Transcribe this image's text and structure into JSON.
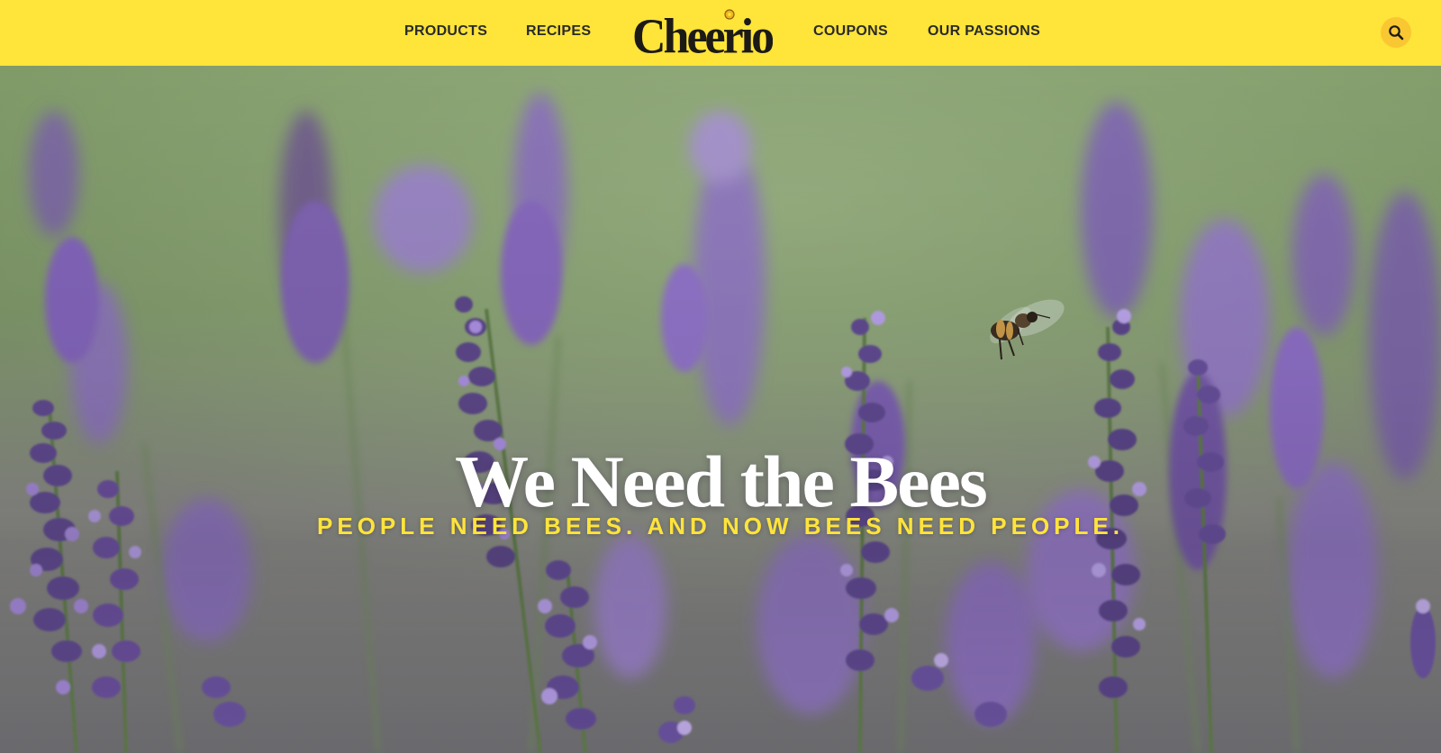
{
  "brand": {
    "logo_text": "Cheerios",
    "nav_bg": "#ffe43a",
    "accent_yellow": "#ffe43a",
    "search_bg": "#f9c731"
  },
  "nav": {
    "products": "PRODUCTS",
    "recipes": "RECIPES",
    "coupons": "COUPONS",
    "passions": "OUR PASSIONS",
    "search_icon": "search-icon"
  },
  "hero": {
    "title": "We Need the Bees",
    "subtitle": "PEOPLE NEED BEES. AND NOW BEES NEED PEOPLE.",
    "image": "lavender field with honeybee"
  }
}
